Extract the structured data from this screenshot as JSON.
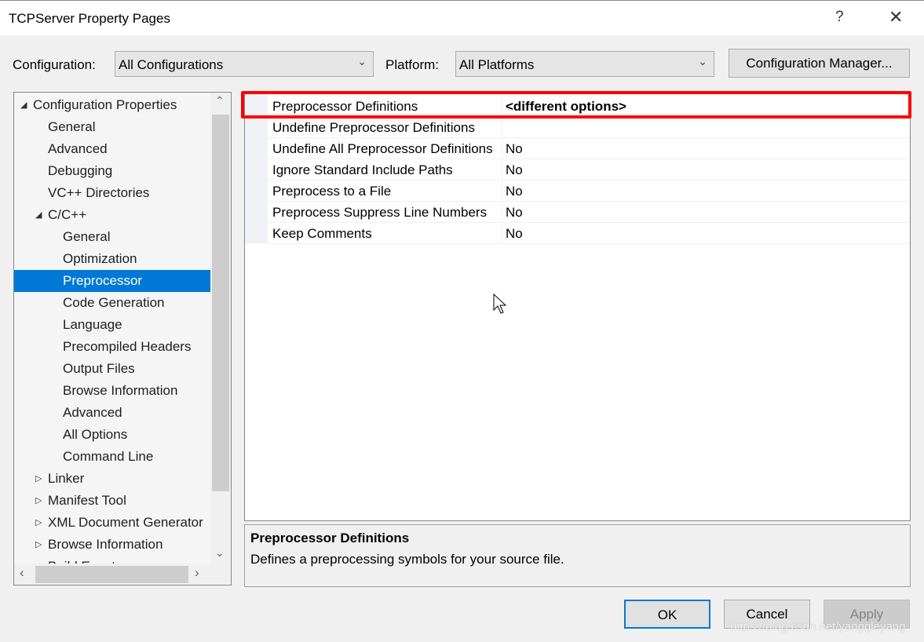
{
  "window": {
    "title": "TCPServer Property Pages",
    "help": "?",
    "close": "✕"
  },
  "config": {
    "configuration_label": "Configuration:",
    "configuration_value": "All Configurations",
    "platform_label": "Platform:",
    "platform_value": "All Platforms",
    "manager_button": "Configuration Manager..."
  },
  "tree": {
    "items": [
      {
        "label": "Configuration Properties",
        "level": 0,
        "expanded": true
      },
      {
        "label": "General",
        "level": 1
      },
      {
        "label": "Advanced",
        "level": 1
      },
      {
        "label": "Debugging",
        "level": 1
      },
      {
        "label": "VC++ Directories",
        "level": 1
      },
      {
        "label": "C/C++",
        "level": 1,
        "expanded": true
      },
      {
        "label": "General",
        "level": 2
      },
      {
        "label": "Optimization",
        "level": 2
      },
      {
        "label": "Preprocessor",
        "level": 2,
        "selected": true
      },
      {
        "label": "Code Generation",
        "level": 2
      },
      {
        "label": "Language",
        "level": 2
      },
      {
        "label": "Precompiled Headers",
        "level": 2
      },
      {
        "label": "Output Files",
        "level": 2
      },
      {
        "label": "Browse Information",
        "level": 2
      },
      {
        "label": "Advanced",
        "level": 2
      },
      {
        "label": "All Options",
        "level": 2
      },
      {
        "label": "Command Line",
        "level": 2
      },
      {
        "label": "Linker",
        "level": 1,
        "expanded": false
      },
      {
        "label": "Manifest Tool",
        "level": 1,
        "expanded": false
      },
      {
        "label": "XML Document Generator",
        "level": 1,
        "expanded": false
      },
      {
        "label": "Browse Information",
        "level": 1,
        "expanded": false
      },
      {
        "label": "Build Events",
        "level": 1,
        "expanded": false
      }
    ]
  },
  "grid": {
    "rows": [
      {
        "name": "Preprocessor Definitions",
        "value": "<different options>",
        "bold": true
      },
      {
        "name": "Undefine Preprocessor Definitions",
        "value": ""
      },
      {
        "name": "Undefine All Preprocessor Definitions",
        "value": "No"
      },
      {
        "name": "Ignore Standard Include Paths",
        "value": "No"
      },
      {
        "name": "Preprocess to a File",
        "value": "No"
      },
      {
        "name": "Preprocess Suppress Line Numbers",
        "value": "No"
      },
      {
        "name": "Keep Comments",
        "value": "No"
      }
    ]
  },
  "description": {
    "title": "Preprocessor Definitions",
    "text": "Defines a preprocessing symbols for your source file."
  },
  "buttons": {
    "ok": "OK",
    "cancel": "Cancel",
    "apply": "Apply"
  },
  "watermark": "https://blog.csdn.net/yanggleyang",
  "colors": {
    "selection": "#0078d7",
    "highlight_box": "#ff0000"
  }
}
